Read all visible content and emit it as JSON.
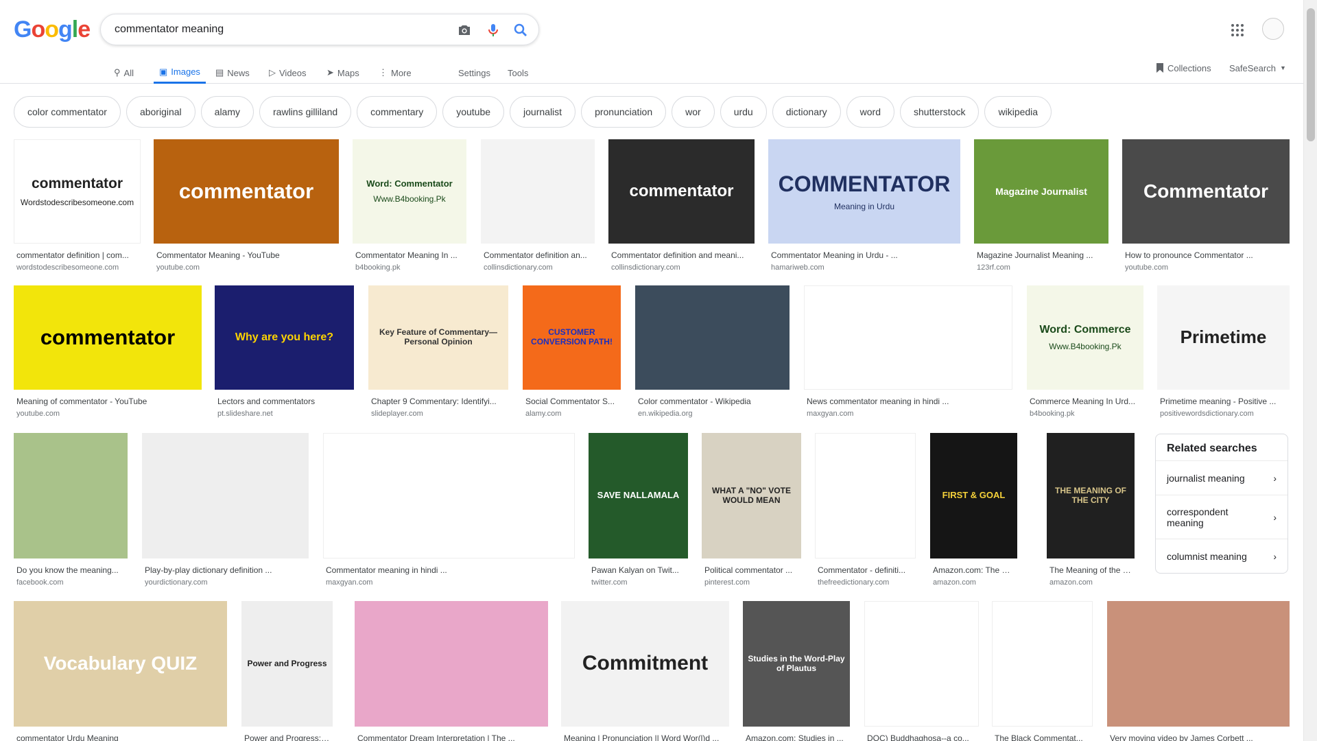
{
  "logo": [
    "G",
    "o",
    "o",
    "g",
    "l",
    "e"
  ],
  "search": {
    "query": "commentator meaning"
  },
  "tabs": [
    {
      "label": "All",
      "icon": "search-icon"
    },
    {
      "label": "Images",
      "icon": "image-icon"
    },
    {
      "label": "News",
      "icon": "news-icon"
    },
    {
      "label": "Videos",
      "icon": "video-icon"
    },
    {
      "label": "Maps",
      "icon": "map-icon"
    },
    {
      "label": "More",
      "icon": "more-vert-icon"
    }
  ],
  "tools": {
    "settings": "Settings",
    "tools": "Tools"
  },
  "right_nav": {
    "collections": "Collections",
    "safesearch": "SafeSearch"
  },
  "chips": [
    "color commentator",
    "aboriginal",
    "alamy",
    "rawlins gilliland",
    "commentary",
    "youtube",
    "journalist",
    "pronunciation",
    "wor",
    "urdu",
    "dictionary",
    "word",
    "shutterstock",
    "wikipedia"
  ],
  "results": [
    {
      "caption": "commentator definition | com...",
      "domain": "wordstodescribesomeone.com",
      "thumb_text": "commentator",
      "thumb_sub": "Wordstodescribesomeone.com"
    },
    {
      "caption": "Commentator Meaning - YouTube",
      "domain": "youtube.com",
      "thumb_text": "commentator"
    },
    {
      "caption": "Commentator Meaning In ...",
      "domain": "b4booking.pk",
      "thumb_text": "Word: Commentator",
      "thumb_sub": "Www.B4booking.Pk"
    },
    {
      "caption": "Commentator definition an...",
      "domain": "collinsdictionary.com"
    },
    {
      "caption": "Commentator definition and meani...",
      "domain": "collinsdictionary.com",
      "thumb_text": "commentator"
    },
    {
      "caption": "Commentator Meaning in Urdu - ...",
      "domain": "hamariweb.com",
      "thumb_text": "COMMENTATOR",
      "thumb_sub": "Meaning in Urdu"
    },
    {
      "caption": "Magazine Journalist Meaning ...",
      "domain": "123rf.com",
      "thumb_text": "Magazine Journalist"
    },
    {
      "caption": "How to pronounce Commentator ...",
      "domain": "youtube.com",
      "thumb_text": "Commentator"
    },
    {
      "caption": "Meaning of commentator - YouTube",
      "domain": "youtube.com",
      "thumb_text": "commentator"
    },
    {
      "caption": "Lectors and commentators",
      "domain": "pt.slideshare.net",
      "thumb_text": "Why are you here?"
    },
    {
      "caption": "Chapter 9 Commentary: Identifyi...",
      "domain": "slideplayer.com",
      "thumb_text": "Key Feature of Commentary— Personal Opinion"
    },
    {
      "caption": "Social Commentator S...",
      "domain": "alamy.com",
      "thumb_text": "CUSTOMER CONVERSION PATH!"
    },
    {
      "caption": "Color commentator - Wikipedia",
      "domain": "en.wikipedia.org"
    },
    {
      "caption": "News commentator meaning in hindi ...",
      "domain": "maxgyan.com"
    },
    {
      "caption": "Commerce Meaning In Urd...",
      "domain": "b4booking.pk",
      "thumb_text": "Word: Commerce",
      "thumb_sub": "Www.B4booking.Pk"
    },
    {
      "caption": "Primetime meaning - Positive ...",
      "domain": "positivewordsdictionary.com",
      "thumb_text": "Primetime"
    },
    {
      "caption": "Do you know the meaning...",
      "domain": "facebook.com"
    },
    {
      "caption": "Play-by-play dictionary definition ...",
      "domain": "yourdictionary.com"
    },
    {
      "caption": "Commentator meaning in hindi ...",
      "domain": "maxgyan.com"
    },
    {
      "caption": "Pawan Kalyan on Twit...",
      "domain": "twitter.com",
      "thumb_text": "SAVE NALLAMALA"
    },
    {
      "caption": "Political commentator ...",
      "domain": "pinterest.com",
      "thumb_text": "WHAT A \"NO\" VOTE WOULD MEAN"
    },
    {
      "caption": "Commentator - definiti...",
      "domain": "thefreedictionary.com"
    },
    {
      "caption": "Amazon.com: The Gri...",
      "domain": "amazon.com",
      "thumb_text": "FIRST & GOAL"
    },
    {
      "caption": "The Meaning of the Ci...",
      "domain": "amazon.com",
      "thumb_text": "THE MEANING OF THE CITY"
    },
    {
      "caption": "commentator Urdu Meaning",
      "domain": "",
      "thumb_text": "Vocabulary QUIZ"
    },
    {
      "caption": "Power and Progress: J...",
      "domain": "",
      "thumb_text": "Power and Progress"
    },
    {
      "caption": "Commentator Dream Interpretation | The ...",
      "domain": ""
    },
    {
      "caption": "Meaning | Pronunciation || Word Wor(l)d ...",
      "domain": "",
      "thumb_text": "Commitment"
    },
    {
      "caption": "Amazon.com: Studies in ...",
      "domain": "",
      "thumb_text": "Studies in the Word-Play of Plautus"
    },
    {
      "caption": "DOC) Buddhaghosa--a co...",
      "domain": ""
    },
    {
      "caption": "The Black Commentat...",
      "domain": ""
    },
    {
      "caption": "Very moving video by James Corbett ...",
      "domain": ""
    }
  ],
  "related": {
    "title": "Related searches",
    "items": [
      "journalist meaning",
      "correspondent meaning",
      "columnist meaning"
    ]
  },
  "colors": {
    "accent": "#1a73e8",
    "caption": "#3c4043",
    "domain": "#70757a"
  }
}
